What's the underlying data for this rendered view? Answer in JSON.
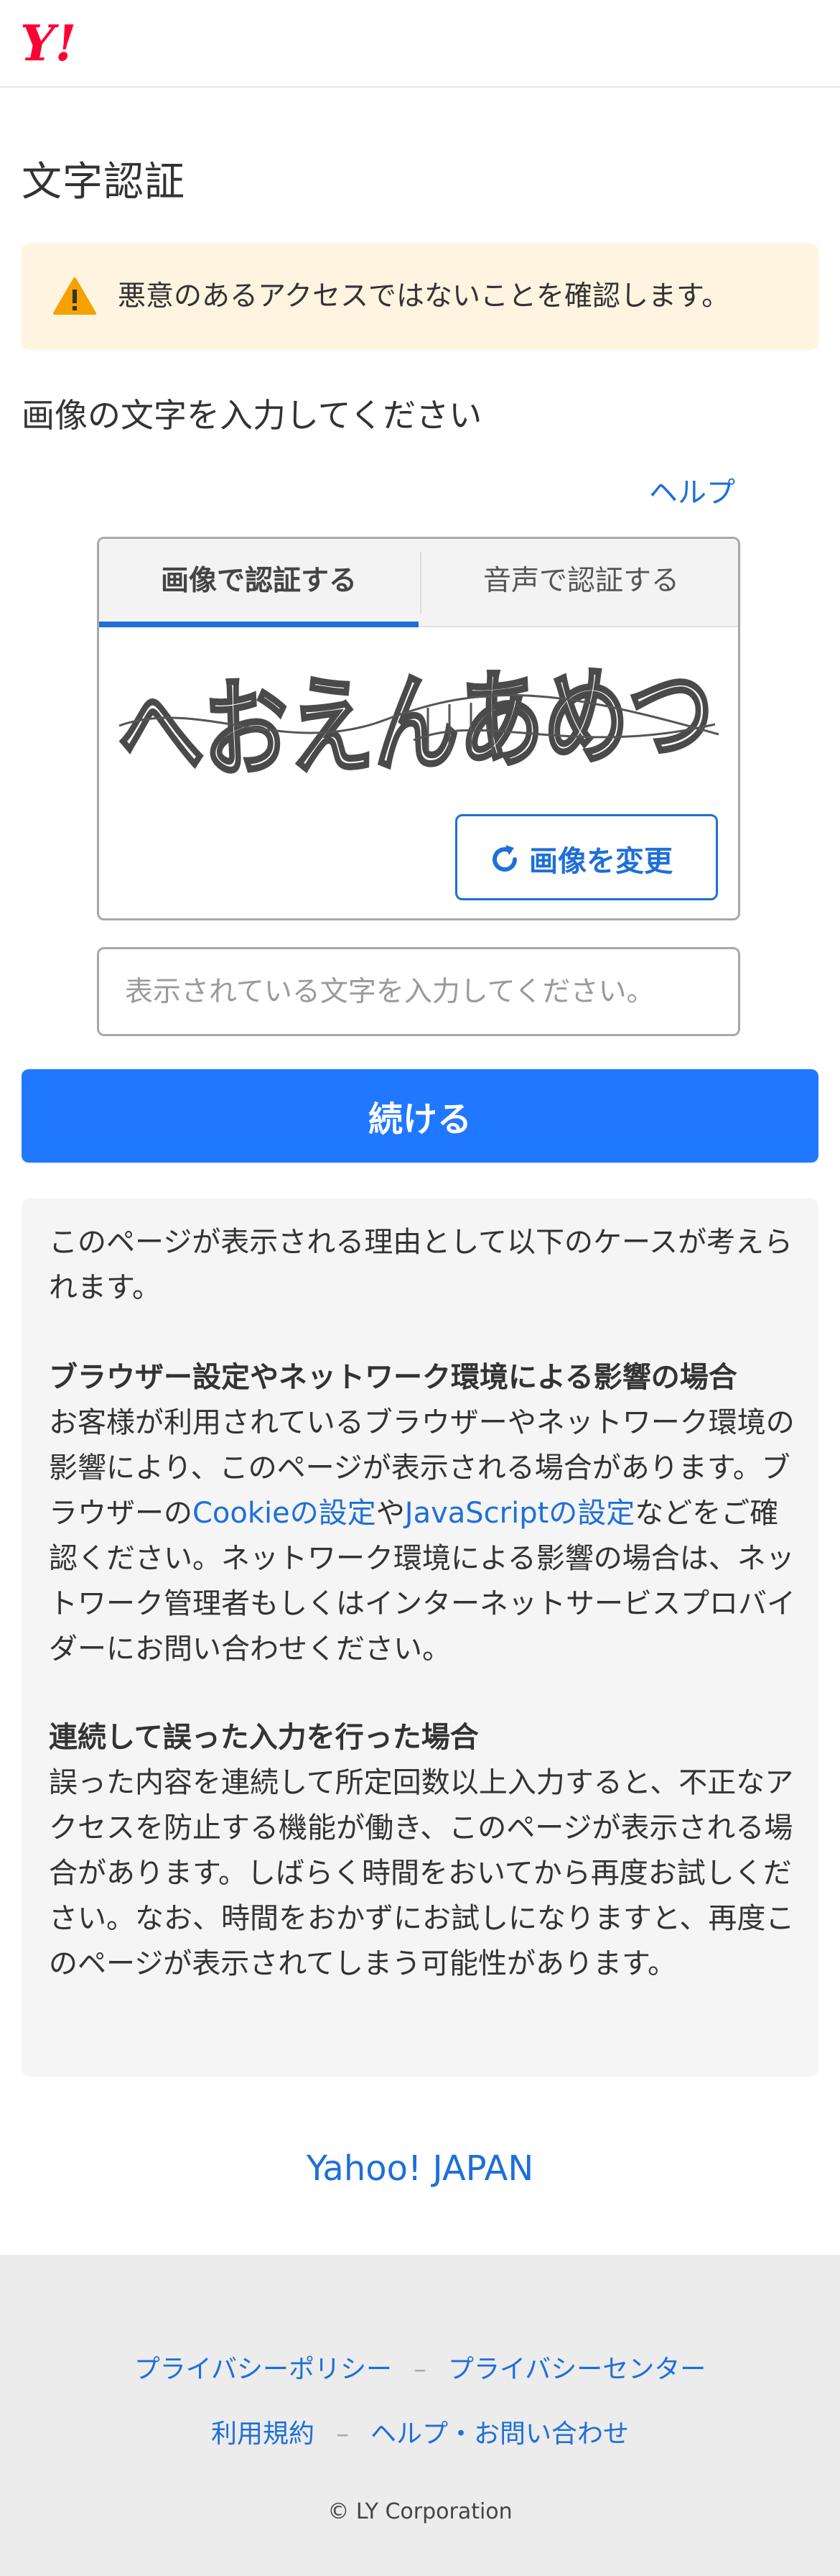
{
  "header": {
    "logo_text": "Y!"
  },
  "page": {
    "title": "文字認証"
  },
  "alert": {
    "text": "悪意のあるアクセスではないことを確認します。"
  },
  "instruction": "画像の文字を入力してください",
  "help_label": "ヘルプ",
  "captcha": {
    "tabs": [
      {
        "label": "画像で認証する",
        "active": true
      },
      {
        "label": "音声で認証する",
        "active": false
      }
    ],
    "image_text": "へおえんあめつ",
    "change_button_label": "画像を変更"
  },
  "input": {
    "placeholder": "表示されている文字を入力してください。",
    "value": ""
  },
  "continue_label": "続ける",
  "info": {
    "intro": "このページが表示される理由として以下のケースが考えられます。",
    "section1": {
      "heading": "ブラウザー設定やネットワーク環境による影響の場合",
      "body_a": "お客様が利用されているブラウザーやネットワーク環境の影響により、このページが表示される場合があります。ブラウザーの",
      "cookie_link": "Cookieの設定",
      "body_b": "や",
      "js_link": "JavaScriptの設定",
      "body_c": "などをご確認ください。ネットワーク環境による影響の場合は、ネットワーク管理者もしくはインターネットサービスプロバイダーにお問い合わせください。"
    },
    "section2": {
      "heading": "連続して誤った入力を行った場合",
      "body": "誤った内容を連続して所定回数以上入力すると、不正なアクセスを防止する機能が働き、このページが表示される場合があります。しばらく時間をおいてから再度お試しください。なお、時間をおかずにお試しになりますと、再度このページが表示されてしまう可能性があります。"
    }
  },
  "yahoo_link": "Yahoo! JAPAN",
  "footer": {
    "links_row1": [
      "プライバシーポリシー",
      "プライバシーセンター"
    ],
    "links_row2": [
      "利用規約",
      "ヘルプ・お問い合わせ"
    ],
    "separator": "–",
    "copyright": "© LY Corporation"
  },
  "colors": {
    "accent": "#1e6fd9",
    "button": "#1f78ff",
    "alert_bg": "#fff4e0",
    "warning": "#f5a200"
  },
  "icons": [
    "yahoo-logo",
    "warning-icon",
    "refresh-icon"
  ]
}
